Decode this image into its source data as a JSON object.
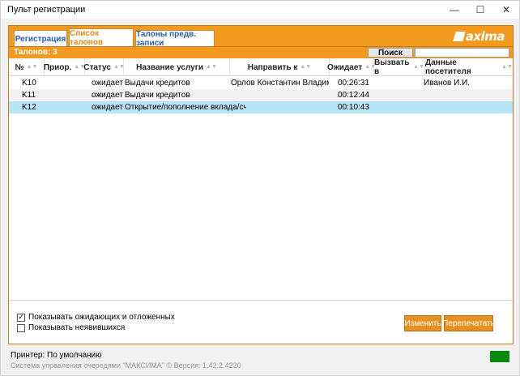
{
  "window": {
    "title": "Пульт регистрации",
    "minimize_glyph": "—",
    "maximize_glyph": "☐",
    "close_glyph": "✕"
  },
  "tabs": [
    {
      "label": "Регистрация",
      "active": false
    },
    {
      "label": "Список талонов",
      "active": true
    },
    {
      "label": "Талоны предв. записи",
      "active": false
    }
  ],
  "logo": {
    "text": "axima",
    "icon": "maxima-logo-icon"
  },
  "tickets": {
    "count_label": "Талонов: 3",
    "search_button": "Поиск",
    "search_value": ""
  },
  "columns": [
    "№",
    "Приор.",
    "Статус",
    "Название услуги",
    "Направить к",
    "Ожидает",
    "Вызвать в",
    "Данные посетителя"
  ],
  "sort_glyph": "▲▼",
  "rows": [
    {
      "num": "K10",
      "prior": "",
      "status": "ожидает",
      "service": "Выдачи кредитов",
      "direct_to": "Орлов Константин Владимирович",
      "waiting": "00:26:31",
      "call_at": "",
      "visitor": "Иванов И.И."
    },
    {
      "num": "K11",
      "prior": "",
      "status": "ожидает",
      "service": "Выдачи кредитов",
      "direct_to": "",
      "waiting": "00:12:44",
      "call_at": "",
      "visitor": ""
    },
    {
      "num": "K12",
      "prior": "",
      "status": "ожидает",
      "service": "Открытие/пополнение вклада/счета",
      "direct_to": "",
      "waiting": "00:10:43",
      "call_at": "",
      "visitor": ""
    }
  ],
  "options": {
    "show_waiting": {
      "label": "Показывать ожидающих и отложенных",
      "checked": true,
      "mark": "✓"
    },
    "show_absent": {
      "label": "Показывать неявившихся",
      "checked": false,
      "mark": ""
    }
  },
  "buttons": {
    "edit": "Изменить",
    "reprint": "Перепечатать"
  },
  "status": {
    "printer": "Принтер:  По умолчанию",
    "version": "Система управления очередями \"МАКСИМА\" © Версия: 1.42.2.4220"
  },
  "colors": {
    "accent": "#f29a1e",
    "selected_row": "#b9e4f8",
    "indicator": "#0a8a0a"
  }
}
